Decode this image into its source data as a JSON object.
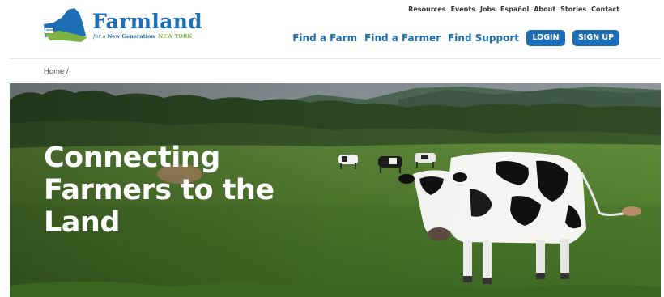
{
  "brand": {
    "name": "Farmland",
    "tagline_for": "for a",
    "tagline_gen": "New Generation",
    "tagline_state": "NEW YORK"
  },
  "utility_nav": [
    "Resources",
    "Events",
    "Jobs",
    "Español",
    "About",
    "Stories",
    "Contact"
  ],
  "main_nav": {
    "find_farm": "Find a Farm",
    "find_farmer": "Find a Farmer",
    "find_support": "Find Support",
    "login": "LOGIN",
    "signup": "SIGN UP"
  },
  "breadcrumb": "Home /",
  "hero": {
    "line1": "Connecting",
    "line2": "Farmers to the",
    "line3": "Land"
  },
  "colors": {
    "brand_blue": "#1e6eb5",
    "brand_green": "#7cb342"
  }
}
